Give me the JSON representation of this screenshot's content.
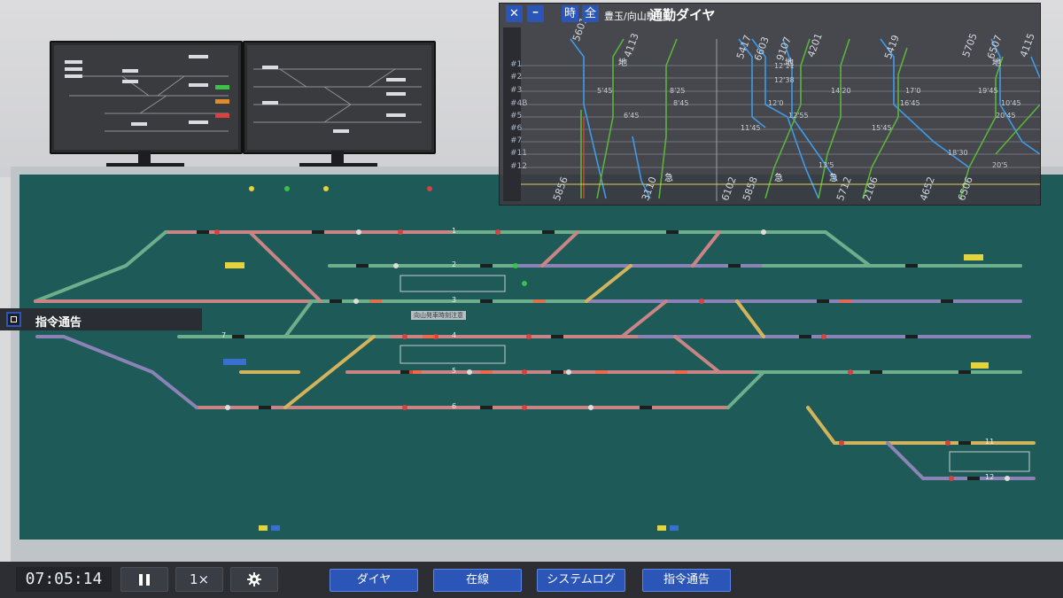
{
  "diagram_window": {
    "close_label": "✕",
    "minimize_label": "━",
    "time_button": "時",
    "all_button": "全",
    "station": "豊玉/向山駅",
    "title": "通勤ダイヤ",
    "track_labels": [
      "#1",
      "#2",
      "#3",
      "#4B",
      "#5",
      "#6",
      "#7",
      "#11",
      "#12"
    ],
    "top_trains": [
      "5601",
      "4113",
      "5417",
      "6603",
      "9107",
      "4201",
      "5419",
      "5705",
      "6507",
      "4115"
    ],
    "bottom_trains": [
      "5856",
      "3110",
      "6102",
      "5858",
      "5712",
      "2106",
      "4652",
      "6506"
    ],
    "chi_marks": [
      "地",
      "地",
      "地"
    ],
    "kyu_marks": [
      "急",
      "急",
      "急"
    ],
    "times": [
      "5'45",
      "8'25",
      "12'11",
      "12'38",
      "14'20",
      "17'0",
      "19'45",
      "6'45",
      "8'45",
      "12'0",
      "16'45",
      "12'55",
      "11'45",
      "20'45",
      "15'45",
      "13'5",
      "18'30",
      "20'5",
      "10'45"
    ]
  },
  "notice": {
    "label": "指令通告"
  },
  "panel": {
    "platforms": [
      "1",
      "2",
      "3",
      "4",
      "5",
      "6",
      "7",
      "11",
      "12"
    ],
    "center_label": "向山発車時刻注意"
  },
  "bottom": {
    "clock": "07:05:14",
    "pause_icon": "pause-icon",
    "speed": "1×",
    "settings_icon": "gear-icon",
    "nav": [
      "ダイヤ",
      "在線",
      "システムログ",
      "指令通告"
    ]
  },
  "colors": {
    "accent": "#2b56b8",
    "panel_bg": "#1e5a57",
    "track_green": "#6fae8c",
    "track_red": "#c98585",
    "track_purple": "#8b82b6",
    "track_yellow": "#d3b35c"
  }
}
